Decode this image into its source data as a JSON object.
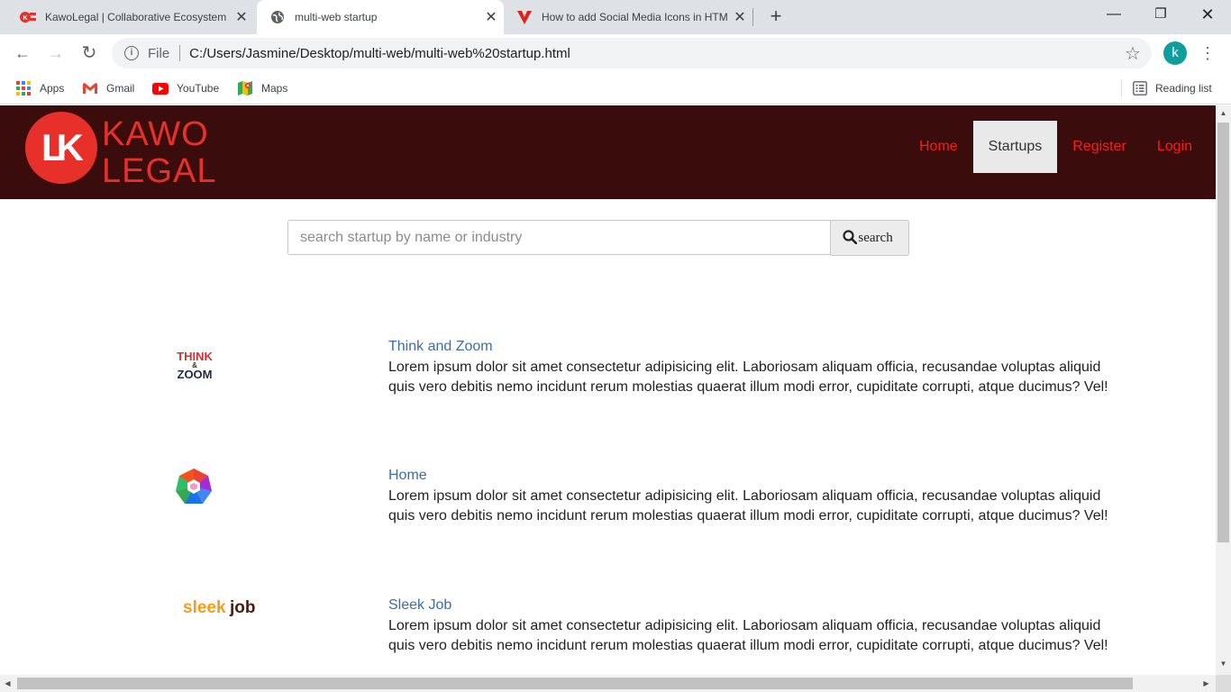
{
  "browser": {
    "tabs": [
      {
        "title": "KawoLegal | Collaborative Ecosystem",
        "active": false
      },
      {
        "title": "multi-web startup",
        "active": true
      },
      {
        "title": "How to add Social Media Icons in HTML",
        "active": false
      }
    ],
    "address": {
      "scheme_label": "File",
      "url": "C:/Users/Jasmine/Desktop/multi-web/multi-web%20startup.html"
    },
    "profile_initial": "k",
    "bookmarks": [
      {
        "label": "Apps",
        "icon": "apps-grid-icon"
      },
      {
        "label": "Gmail",
        "icon": "gmail-icon"
      },
      {
        "label": "YouTube",
        "icon": "youtube-icon"
      },
      {
        "label": "Maps",
        "icon": "maps-icon"
      }
    ],
    "reading_list_label": "Reading list"
  },
  "site": {
    "logo_text_top": "KAWO",
    "logo_text_bottom": "LEGAL",
    "logo_monogram": "LK",
    "nav": [
      {
        "label": "Home",
        "active": false
      },
      {
        "label": "Startups",
        "active": true
      },
      {
        "label": "Register",
        "active": false
      },
      {
        "label": "Login",
        "active": false
      }
    ],
    "search": {
      "placeholder": "search startup by name or industry",
      "button_label": "search"
    },
    "startups": [
      {
        "name": "Think and Zoom",
        "logo_lines": [
          "THINK",
          "&",
          "ZOOM"
        ],
        "desc_line1": "Lorem ipsum dolor sit amet consectetur adipisicing elit. Laboriosam aliquam officia, recusandae voluptas aliquid",
        "desc_line2": "quis vero debitis nemo incidunt rerum molestias quaerat illum modi error, cupiditate corrupti, atque ducimus? Vel!"
      },
      {
        "name": "Home",
        "logo_lines": [],
        "desc_line1": "Lorem ipsum dolor sit amet consectetur adipisicing elit. Laboriosam aliquam officia, recusandae voluptas aliquid",
        "desc_line2": "quis vero debitis nemo incidunt rerum molestias quaerat illum modi error, cupiditate corrupti, atque ducimus? Vel!"
      },
      {
        "name": "Sleek Job",
        "logo_lines": [
          "sleek",
          "job"
        ],
        "desc_line1": "Lorem ipsum dolor sit amet consectetur adipisicing elit. Laboriosam aliquam officia, recusandae voluptas aliquid",
        "desc_line2": "quis vero debitis nemo incidunt rerum molestias quaerat illum modi error, cupiditate corrupti, atque ducimus? Vel!"
      }
    ]
  },
  "colors": {
    "header_bg": "#3a0c0c",
    "nav_link": "#ff1a1a",
    "logo_red": "#e8302a",
    "startup_link": "#3a6ea5"
  }
}
